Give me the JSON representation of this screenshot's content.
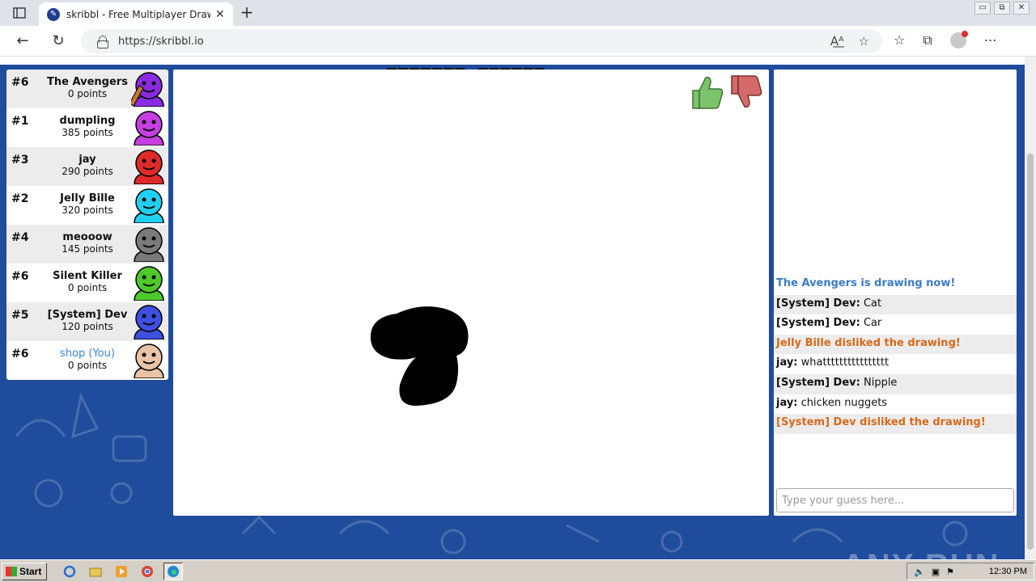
{
  "browser": {
    "tab_title": "skribbl - Free Multiplayer Drawing",
    "url": "https://skribbl.io",
    "win_controls": [
      "▭",
      "⧉",
      "✕"
    ]
  },
  "game": {
    "word_hint": "_______ ______"
  },
  "players": [
    {
      "rank": "#6",
      "name": "The Avengers",
      "points": "0 points",
      "avatar_color": "#8a2be2",
      "drawing": true
    },
    {
      "rank": "#1",
      "name": "dumpling",
      "points": "385 points",
      "avatar_color": "#c63fe0"
    },
    {
      "rank": "#3",
      "name": "jay",
      "points": "290 points",
      "avatar_color": "#e02a2a"
    },
    {
      "rank": "#2",
      "name": "Jelly Bille",
      "points": "320 points",
      "avatar_color": "#1fd0f0"
    },
    {
      "rank": "#4",
      "name": "meooow",
      "points": "145 points",
      "avatar_color": "#7a7a7a"
    },
    {
      "rank": "#6",
      "name": "Silent Killer",
      "points": "0 points",
      "avatar_color": "#4ec92a"
    },
    {
      "rank": "#5",
      "name": "[System] Dev",
      "points": "120 points",
      "avatar_color": "#3f4fe0"
    },
    {
      "rank": "#6",
      "name": "shop (You)",
      "points": "0 points",
      "avatar_color": "#e9c4a6",
      "you": true
    }
  ],
  "chat": {
    "messages": [
      {
        "type": "system-blue",
        "text": "The Avengers is drawing now!"
      },
      {
        "type": "normal",
        "author": "[System] Dev:",
        "text": " Cat"
      },
      {
        "type": "normal",
        "author": "[System] Dev:",
        "text": " Car"
      },
      {
        "type": "system-orange",
        "text": "Jelly Bille disliked the drawing!"
      },
      {
        "type": "normal",
        "author": "jay:",
        "text": " whatttttttttttttttt"
      },
      {
        "type": "normal",
        "author": "[System] Dev:",
        "text": " Nipple"
      },
      {
        "type": "normal",
        "author": "jay:",
        "text": " chicken nuggets"
      },
      {
        "type": "system-orange",
        "text": "[System] Dev disliked the drawing!"
      }
    ],
    "input_placeholder": "Type your guess here..."
  },
  "watermark": "ANY RUN",
  "taskbar": {
    "start_label": "Start",
    "clock": "12:30 PM"
  },
  "colors": {
    "page_bg": "#1f4c9c",
    "system_blue": "#3a7bc8",
    "system_orange": "#d8691a"
  }
}
